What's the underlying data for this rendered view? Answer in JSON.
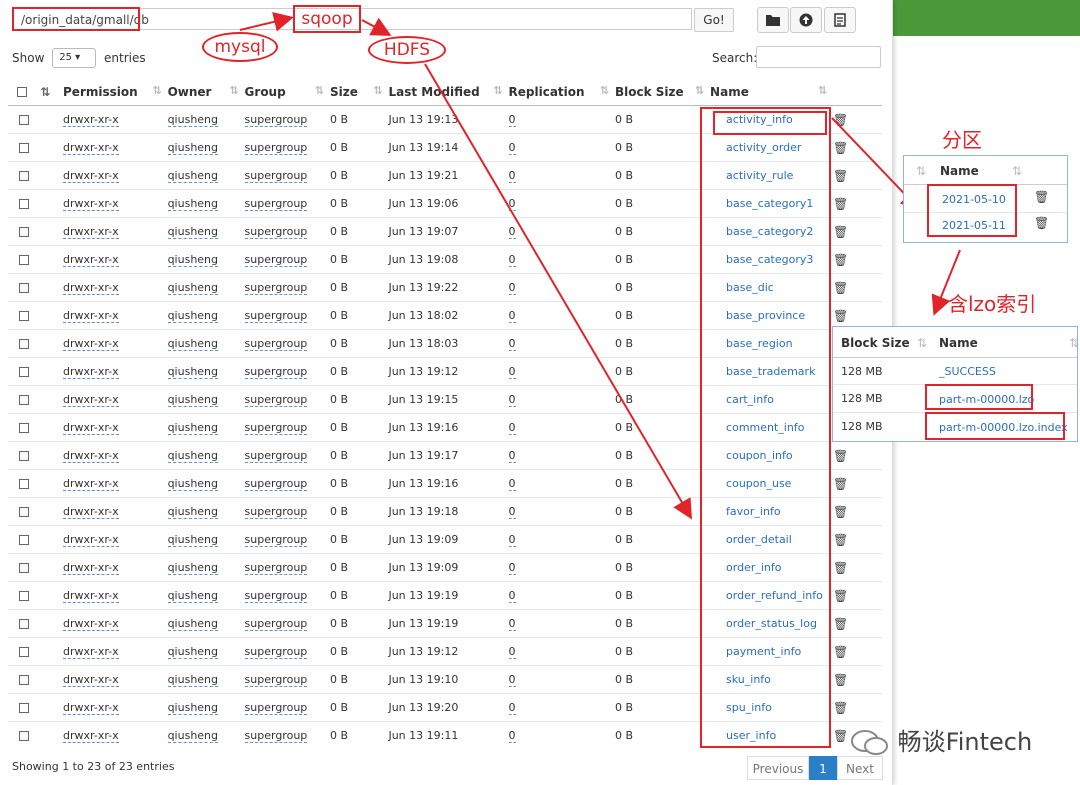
{
  "toolbar": {
    "path_value": "/origin_data/gmall/db",
    "go_label": "Go!",
    "folder_icon": "folder-open-icon",
    "upload_icon": "upload-icon",
    "file_icon": "new-file-icon"
  },
  "length_menu": {
    "show_label": "Show",
    "selected": "25",
    "entries_label": "entries"
  },
  "search": {
    "label": "Search:",
    "value": ""
  },
  "table": {
    "headers": [
      "Permission",
      "Owner",
      "Group",
      "Size",
      "Last Modified",
      "Replication",
      "Block Size",
      "Name"
    ],
    "rows": [
      {
        "perm": "drwxr-xr-x",
        "owner": "qiusheng",
        "group": "supergroup",
        "size": "0 B",
        "modified": "Jun 13 19:13",
        "repl": "0",
        "block": "0 B",
        "name": "activity_info"
      },
      {
        "perm": "drwxr-xr-x",
        "owner": "qiusheng",
        "group": "supergroup",
        "size": "0 B",
        "modified": "Jun 13 19:14",
        "repl": "0",
        "block": "0 B",
        "name": "activity_order"
      },
      {
        "perm": "drwxr-xr-x",
        "owner": "qiusheng",
        "group": "supergroup",
        "size": "0 B",
        "modified": "Jun 13 19:21",
        "repl": "0",
        "block": "0 B",
        "name": "activity_rule"
      },
      {
        "perm": "drwxr-xr-x",
        "owner": "qiusheng",
        "group": "supergroup",
        "size": "0 B",
        "modified": "Jun 13 19:06",
        "repl": "0",
        "block": "0 B",
        "name": "base_category1"
      },
      {
        "perm": "drwxr-xr-x",
        "owner": "qiusheng",
        "group": "supergroup",
        "size": "0 B",
        "modified": "Jun 13 19:07",
        "repl": "0",
        "block": "0 B",
        "name": "base_category2"
      },
      {
        "perm": "drwxr-xr-x",
        "owner": "qiusheng",
        "group": "supergroup",
        "size": "0 B",
        "modified": "Jun 13 19:08",
        "repl": "0",
        "block": "0 B",
        "name": "base_category3"
      },
      {
        "perm": "drwxr-xr-x",
        "owner": "qiusheng",
        "group": "supergroup",
        "size": "0 B",
        "modified": "Jun 13 19:22",
        "repl": "0",
        "block": "0 B",
        "name": "base_dic"
      },
      {
        "perm": "drwxr-xr-x",
        "owner": "qiusheng",
        "group": "supergroup",
        "size": "0 B",
        "modified": "Jun 13 18:02",
        "repl": "0",
        "block": "0 B",
        "name": "base_province"
      },
      {
        "perm": "drwxr-xr-x",
        "owner": "qiusheng",
        "group": "supergroup",
        "size": "0 B",
        "modified": "Jun 13 18:03",
        "repl": "0",
        "block": "0 B",
        "name": "base_region"
      },
      {
        "perm": "drwxr-xr-x",
        "owner": "qiusheng",
        "group": "supergroup",
        "size": "0 B",
        "modified": "Jun 13 19:12",
        "repl": "0",
        "block": "0 B",
        "name": "base_trademark"
      },
      {
        "perm": "drwxr-xr-x",
        "owner": "qiusheng",
        "group": "supergroup",
        "size": "0 B",
        "modified": "Jun 13 19:15",
        "repl": "0",
        "block": "0 B",
        "name": "cart_info"
      },
      {
        "perm": "drwxr-xr-x",
        "owner": "qiusheng",
        "group": "supergroup",
        "size": "0 B",
        "modified": "Jun 13 19:16",
        "repl": "0",
        "block": "0 B",
        "name": "comment_info"
      },
      {
        "perm": "drwxr-xr-x",
        "owner": "qiusheng",
        "group": "supergroup",
        "size": "0 B",
        "modified": "Jun 13 19:17",
        "repl": "0",
        "block": "0 B",
        "name": "coupon_info"
      },
      {
        "perm": "drwxr-xr-x",
        "owner": "qiusheng",
        "group": "supergroup",
        "size": "0 B",
        "modified": "Jun 13 19:16",
        "repl": "0",
        "block": "0 B",
        "name": "coupon_use"
      },
      {
        "perm": "drwxr-xr-x",
        "owner": "qiusheng",
        "group": "supergroup",
        "size": "0 B",
        "modified": "Jun 13 19:18",
        "repl": "0",
        "block": "0 B",
        "name": "favor_info"
      },
      {
        "perm": "drwxr-xr-x",
        "owner": "qiusheng",
        "group": "supergroup",
        "size": "0 B",
        "modified": "Jun 13 19:09",
        "repl": "0",
        "block": "0 B",
        "name": "order_detail"
      },
      {
        "perm": "drwxr-xr-x",
        "owner": "qiusheng",
        "group": "supergroup",
        "size": "0 B",
        "modified": "Jun 13 19:09",
        "repl": "0",
        "block": "0 B",
        "name": "order_info"
      },
      {
        "perm": "drwxr-xr-x",
        "owner": "qiusheng",
        "group": "supergroup",
        "size": "0 B",
        "modified": "Jun 13 19:19",
        "repl": "0",
        "block": "0 B",
        "name": "order_refund_info"
      },
      {
        "perm": "drwxr-xr-x",
        "owner": "qiusheng",
        "group": "supergroup",
        "size": "0 B",
        "modified": "Jun 13 19:19",
        "repl": "0",
        "block": "0 B",
        "name": "order_status_log"
      },
      {
        "perm": "drwxr-xr-x",
        "owner": "qiusheng",
        "group": "supergroup",
        "size": "0 B",
        "modified": "Jun 13 19:12",
        "repl": "0",
        "block": "0 B",
        "name": "payment_info"
      },
      {
        "perm": "drwxr-xr-x",
        "owner": "qiusheng",
        "group": "supergroup",
        "size": "0 B",
        "modified": "Jun 13 19:10",
        "repl": "0",
        "block": "0 B",
        "name": "sku_info"
      },
      {
        "perm": "drwxr-xr-x",
        "owner": "qiusheng",
        "group": "supergroup",
        "size": "0 B",
        "modified": "Jun 13 19:20",
        "repl": "0",
        "block": "0 B",
        "name": "spu_info"
      },
      {
        "perm": "drwxr-xr-x",
        "owner": "qiusheng",
        "group": "supergroup",
        "size": "0 B",
        "modified": "Jun 13 19:11",
        "repl": "0",
        "block": "0 B",
        "name": "user_info"
      }
    ]
  },
  "footer": {
    "info": "Showing 1 to 23 of 23 entries",
    "previous": "Previous",
    "page": "1",
    "next": "Next"
  },
  "annotations": {
    "mysql": "mysql",
    "sqoop": "sqoop",
    "hdfs": "HDFS",
    "partition": "分区",
    "lzo_index": "含lzo索引",
    "accent_color": "#e0242a"
  },
  "partition_panel": {
    "header": "Name",
    "items": [
      "2021-05-10",
      "2021-05-11"
    ]
  },
  "lzo_panel": {
    "headers": [
      "Block Size",
      "Name"
    ],
    "rows": [
      {
        "block": "128 MB",
        "name": "_SUCCESS"
      },
      {
        "block": "128 MB",
        "name": "part-m-00000.lzo"
      },
      {
        "block": "128 MB",
        "name": "part-m-00000.lzo.index"
      }
    ]
  },
  "watermark": "畅谈Fintech"
}
